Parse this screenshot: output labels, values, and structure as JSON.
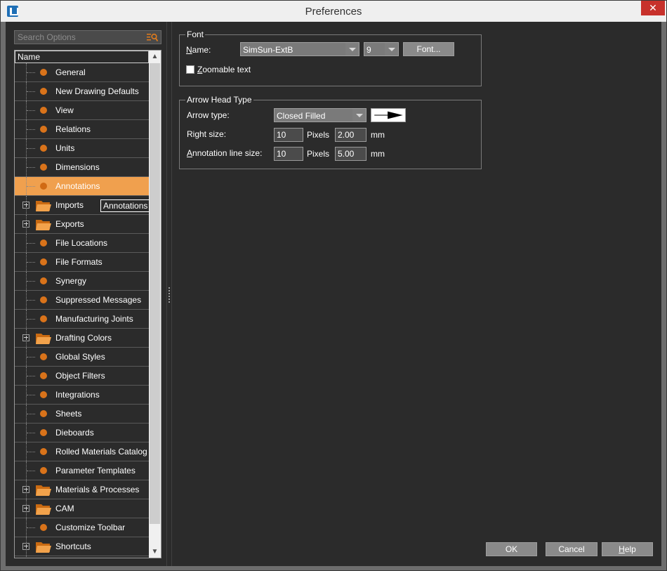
{
  "window": {
    "title": "Preferences",
    "close_label": "✕"
  },
  "search": {
    "placeholder": "Search Options"
  },
  "tree": {
    "header": "Name",
    "tooltip": "Annotations",
    "items": [
      {
        "label": "General",
        "type": "leaf"
      },
      {
        "label": "New Drawing Defaults",
        "type": "leaf"
      },
      {
        "label": "View",
        "type": "leaf"
      },
      {
        "label": "Relations",
        "type": "leaf"
      },
      {
        "label": "Units",
        "type": "leaf"
      },
      {
        "label": "Dimensions",
        "type": "leaf"
      },
      {
        "label": "Annotations",
        "type": "leaf",
        "selected": true
      },
      {
        "label": "Imports",
        "type": "folder"
      },
      {
        "label": "Exports",
        "type": "folder"
      },
      {
        "label": "File Locations",
        "type": "leaf"
      },
      {
        "label": "File Formats",
        "type": "leaf"
      },
      {
        "label": "Synergy",
        "type": "leaf"
      },
      {
        "label": "Suppressed Messages",
        "type": "leaf"
      },
      {
        "label": "Manufacturing Joints",
        "type": "leaf"
      },
      {
        "label": "Drafting Colors",
        "type": "folder"
      },
      {
        "label": "Global Styles",
        "type": "leaf"
      },
      {
        "label": "Object Filters",
        "type": "leaf"
      },
      {
        "label": "Integrations",
        "type": "leaf"
      },
      {
        "label": "Sheets",
        "type": "leaf"
      },
      {
        "label": "Dieboards",
        "type": "leaf"
      },
      {
        "label": "Rolled Materials Catalog",
        "type": "leaf"
      },
      {
        "label": "Parameter Templates",
        "type": "leaf"
      },
      {
        "label": "Materials & Processes",
        "type": "folder"
      },
      {
        "label": "CAM",
        "type": "folder"
      },
      {
        "label": "Customize Toolbar",
        "type": "leaf"
      },
      {
        "label": "Shortcuts",
        "type": "folder"
      }
    ]
  },
  "font_group": {
    "title": "Font",
    "name_label_prefix": "N",
    "name_label_rest": "ame:",
    "font_name": "SimSun-ExtB",
    "font_size": "9",
    "font_button": "Font...",
    "zoomable_prefix": "Z",
    "zoomable_rest": "oomable text"
  },
  "arrow_group": {
    "title": "Arrow Head Type",
    "arrow_type_label": "Arrow type:",
    "arrow_type_value": "Closed Filled",
    "right_size_label": "Right size:",
    "right_size_pixels": "10",
    "right_size_mm": "2.00",
    "annotation_line_label_prefix": "A",
    "annotation_line_label_rest": "nnotation line size:",
    "annotation_line_pixels": "10",
    "annotation_line_mm": "5.00",
    "pixels_unit": "Pixels",
    "mm_unit": "mm"
  },
  "buttons": {
    "ok": "OK",
    "cancel": "Cancel",
    "help_prefix": "H",
    "help_rest": "elp"
  },
  "colors": {
    "accent": "#f0a04e",
    "bullet": "#d9731a",
    "close": "#c7312b"
  }
}
